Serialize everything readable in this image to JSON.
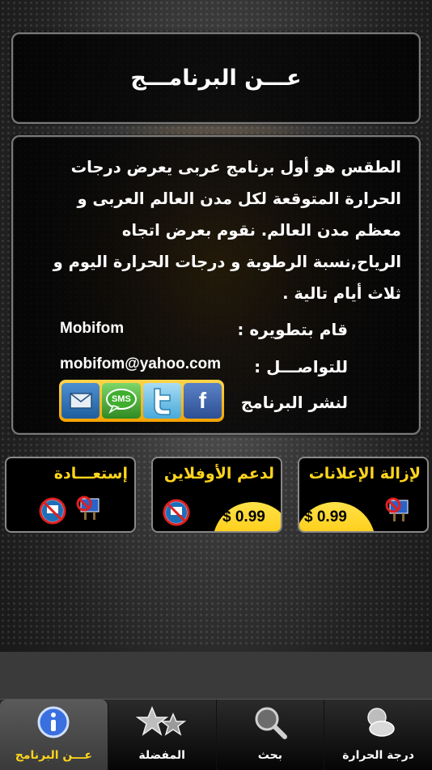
{
  "header": {
    "title": "عـــن البرنامـــج"
  },
  "about": {
    "description": "الطقس هو أول برنامج عربى يعرض درجات الحرارة المتوقعة لكل مدن العالم العربى و معظم مدن العالم. نقوم بعرض اتجاه الرياح,نسبة الرطوبة و درجات الحرارة اليوم و ثلاث أيام تالية .",
    "developer_label": "قام بتطويره :",
    "developer_value": "Mobifom",
    "contact_label": "للتواصـــل :",
    "contact_value": "mobifom@yahoo.com",
    "share_label": "لنشر البرنامج",
    "share_buttons": [
      {
        "icon": "mail-icon",
        "text": ""
      },
      {
        "icon": "sms-icon",
        "text": "SMS"
      },
      {
        "icon": "twitter-icon",
        "text": ""
      },
      {
        "icon": "facebook-icon",
        "text": "f"
      }
    ]
  },
  "purchases": [
    {
      "label": "إستعـــادة",
      "price": ""
    },
    {
      "label": "لدعم الأوفلاين",
      "price": "$ 0.99"
    },
    {
      "label": "لإزالة الإعلانات",
      "price": "$ 0.99"
    }
  ],
  "tabs": [
    {
      "label": "عـــن البرنامج",
      "icon": "info-icon",
      "selected": true
    },
    {
      "label": "المفضلة",
      "icon": "stars-icon",
      "selected": false
    },
    {
      "label": "بحث",
      "icon": "search-icon",
      "selected": false
    },
    {
      "label": "درجة الحرارة",
      "icon": "weather-icon",
      "selected": false
    }
  ],
  "colors": {
    "accent": "#ffd51c",
    "price_badge": "#ffd22e",
    "share_bar": "#f5b400"
  }
}
